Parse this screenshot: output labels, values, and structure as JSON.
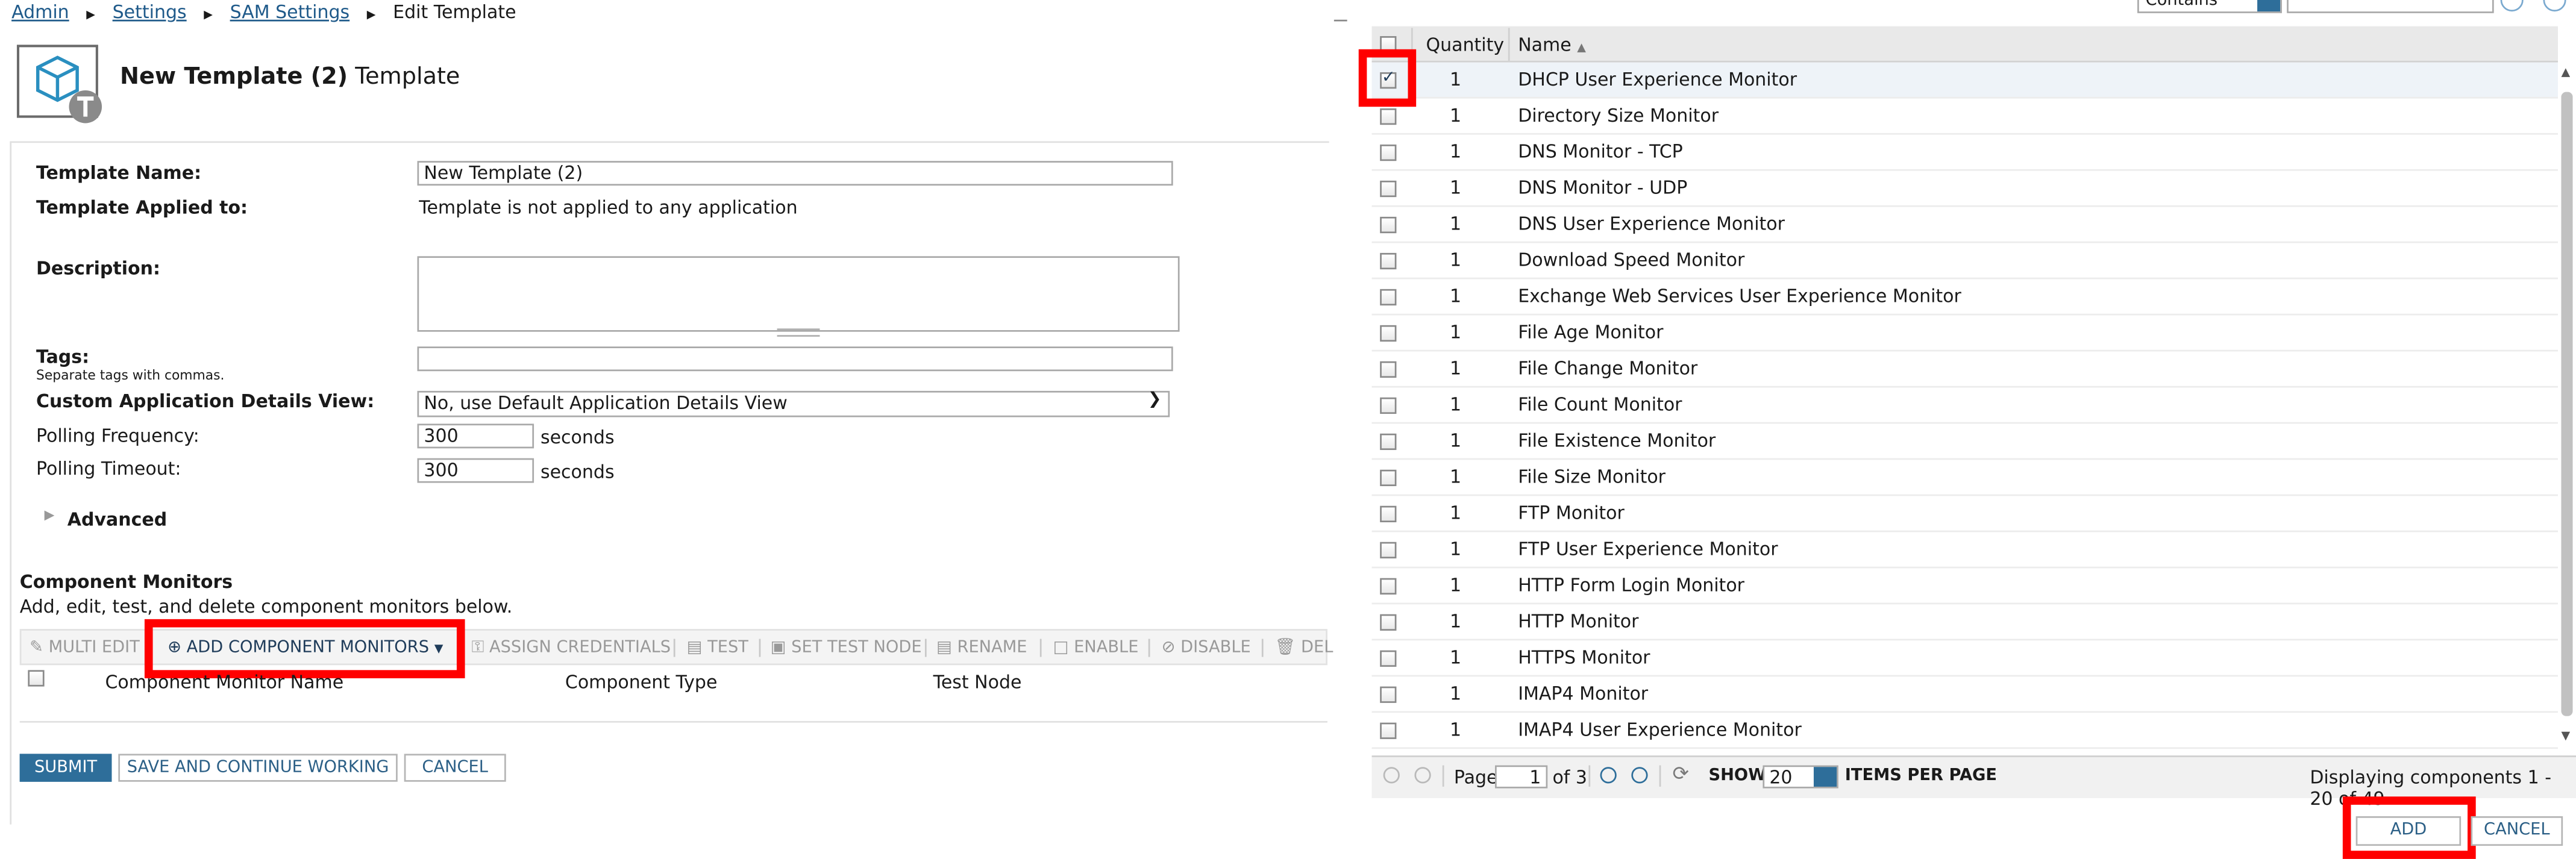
{
  "breadcrumb": {
    "items": [
      "Admin",
      "Settings",
      "SAM Settings"
    ],
    "current": "Edit Template"
  },
  "header": {
    "title_bold": "New Template (2)",
    "title_rest": "Template"
  },
  "form": {
    "template_name_label": "Template Name:",
    "template_name_value": "New Template (2)",
    "applied_label": "Template Applied to:",
    "applied_value": "Template is not applied to any application",
    "description_label": "Description:",
    "tags_label": "Tags:",
    "tags_hint": "Separate tags with commas.",
    "custom_view_label": "Custom Application Details View:",
    "custom_view_value": "No, use Default Application Details View",
    "polling_freq_label": "Polling Frequency:",
    "polling_freq_value": "300",
    "polling_timeout_label": "Polling Timeout:",
    "polling_timeout_value": "300",
    "seconds": "seconds",
    "advanced_label": "Advanced"
  },
  "component_monitors": {
    "title": "Component Monitors",
    "subtitle": "Add, edit, test, and delete component monitors below.",
    "toolbar": {
      "multi_edit": "MULTI EDIT",
      "add": "ADD COMPONENT MONITORS",
      "assign": "ASSIGN CREDENTIALS",
      "test": "TEST",
      "set_test_node": "SET TEST NODE",
      "rename": "RENAME",
      "enable": "ENABLE",
      "disable": "DISABLE",
      "delete": "DEL"
    },
    "columns": [
      "Component Monitor Name",
      "Component Type",
      "Test Node"
    ]
  },
  "actions": {
    "submit": "SUBMIT",
    "save_continue": "SAVE AND CONTINUE WORKING",
    "cancel": "CANCEL"
  },
  "dialog": {
    "filter_select": "Contains",
    "columns": {
      "quantity": "Quantity",
      "name": "Name"
    },
    "rows": [
      {
        "qty": "1",
        "name": "DHCP User Experience Monitor",
        "checked": true
      },
      {
        "qty": "1",
        "name": "Directory Size Monitor",
        "checked": false
      },
      {
        "qty": "1",
        "name": "DNS Monitor - TCP",
        "checked": false
      },
      {
        "qty": "1",
        "name": "DNS Monitor - UDP",
        "checked": false
      },
      {
        "qty": "1",
        "name": "DNS User Experience Monitor",
        "checked": false
      },
      {
        "qty": "1",
        "name": "Download Speed Monitor",
        "checked": false
      },
      {
        "qty": "1",
        "name": "Exchange Web Services User Experience Monitor",
        "checked": false
      },
      {
        "qty": "1",
        "name": "File Age Monitor",
        "checked": false
      },
      {
        "qty": "1",
        "name": "File Change Monitor",
        "checked": false
      },
      {
        "qty": "1",
        "name": "File Count Monitor",
        "checked": false
      },
      {
        "qty": "1",
        "name": "File Existence Monitor",
        "checked": false
      },
      {
        "qty": "1",
        "name": "File Size Monitor",
        "checked": false
      },
      {
        "qty": "1",
        "name": "FTP Monitor",
        "checked": false
      },
      {
        "qty": "1",
        "name": "FTP User Experience Monitor",
        "checked": false
      },
      {
        "qty": "1",
        "name": "HTTP Form Login Monitor",
        "checked": false
      },
      {
        "qty": "1",
        "name": "HTTP Monitor",
        "checked": false
      },
      {
        "qty": "1",
        "name": "HTTPS Monitor",
        "checked": false
      },
      {
        "qty": "1",
        "name": "IMAP4 Monitor",
        "checked": false
      },
      {
        "qty": "1",
        "name": "IMAP4 User Experience Monitor",
        "checked": false
      }
    ],
    "pager": {
      "page_label": "Page",
      "page_value": "1",
      "of_label": "of 3",
      "show_label": "SHOW",
      "per_page_value": "20",
      "items_per_page": "ITEMS PER PAGE",
      "displaying": "Displaying components 1 - 20 of 49"
    },
    "add": "ADD",
    "cancel": "CANCEL"
  },
  "colors": {
    "link": "#1f5a8a",
    "primary": "#2e6e9a",
    "highlight": "#ff0000",
    "header_bg": "#e9e9e9"
  }
}
